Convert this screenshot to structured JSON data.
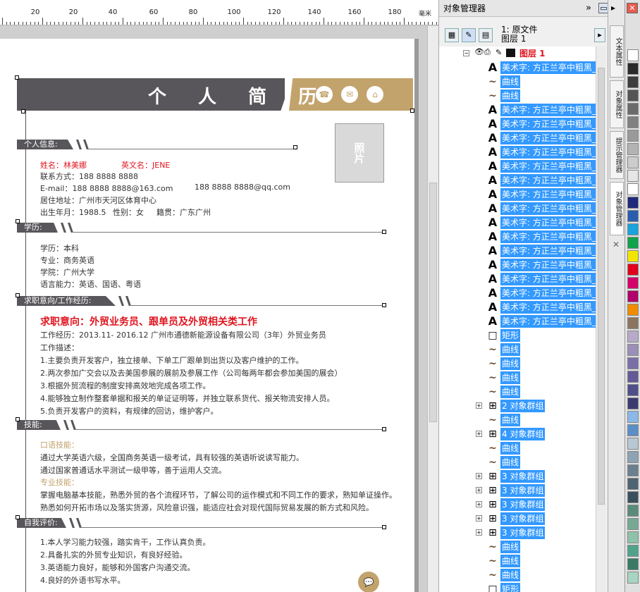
{
  "ruler": {
    "labels": [
      "20",
      "0",
      "20",
      "40",
      "60",
      "80",
      "100",
      "120",
      "140",
      "160",
      "180",
      "200"
    ],
    "unit": "毫米"
  },
  "resume": {
    "title": "个 人 简 历",
    "photo": "照片",
    "sections": {
      "s1": "个人信息:",
      "s2": "学历:",
      "s3": "求职意向/工作经历:",
      "s4": "技能:",
      "s5": "自我评价:"
    },
    "info": [
      "姓名：林美娜",
      "英文名：JENE",
      "联系方式：188 8888 8888",
      "E-mail：188 8888 8888@163.com",
      "188 8888 8888@qq.com",
      "居住地址：广州市天河区体育中心",
      "出生年月：1988.5",
      "性别：女",
      "籍贯：广东广州"
    ],
    "edu": [
      "学历：本科",
      "专业：商务英语",
      "学院：广州大学",
      "语言能力：英语、国语、粤语"
    ],
    "job": {
      "intent": "求职意向：外贸业务员、跟单员及外贸相关类工作",
      "exp": "工作经历：2013.11- 2016.12 广州市通德新能源设备有限公司（3年）外贸业务员",
      "desc": "工作描述：",
      "items": [
        "1.主要负责开发客户，独立接单、下单工厂跟单到出货以及客户维护的工作。",
        "2.两次参加广交会以及去美国参展的展前及参展工作（公司每两年都会参加美国的展会）",
        "3.根据外贸流程的制度安排高效地完成各项工作。",
        "4.能够独立制作整套单据和报关的单证证明等，并独立联系货代、报关物流安排人员。",
        "5.负责开发客户的资料，有规律的回访，维护客户。"
      ]
    },
    "skills": {
      "lang_head": "口语技能：",
      "lang": [
        "通过大学英语六级，全国商务英语一级考试，具有较强的英语听说读写能力。",
        "通过国家普通话水平测试一级甲等，善于运用人交流。"
      ],
      "pro_head": "专业技能：",
      "pro": [
        "掌握电脑基本技能，熟悉外贸的各个流程环节，了解公司的运作模式和不同工作的要求，熟知单证操作。",
        "熟悉如何开拓市场以及落实货源，风险意识强，能适应社会对现代国际贸易发展的新方式和风险。"
      ]
    },
    "eval": [
      "1.本人学习能力较强，踏实肯干，工作认真负责。",
      "2.具备扎实的外贸专业知识，有良好经验。",
      "3.英语能力良好，能够和外国客户沟通交流。",
      "4.良好的外语书写水平。"
    ]
  },
  "docker": {
    "title": "对象管理器",
    "doc_label": "1: 原文件",
    "layer_label": "图层 1",
    "layer_name": "图层 1",
    "rows": [
      {
        "icon": "A",
        "label": "美术字: 方正兰亭中粗黑_"
      },
      {
        "icon": "~",
        "label": "曲线"
      },
      {
        "icon": "~",
        "label": "曲线"
      },
      {
        "icon": "A",
        "label": "美术字: 方正兰亭中粗黑_"
      },
      {
        "icon": "A",
        "label": "美术字: 方正兰亭中粗黑_"
      },
      {
        "icon": "A",
        "label": "美术字: 方正兰亭中粗黑_"
      },
      {
        "icon": "A",
        "label": "美术字: 方正兰亭中粗黑_"
      },
      {
        "icon": "A",
        "label": "美术字: 方正兰亭中粗黑_"
      },
      {
        "icon": "A",
        "label": "美术字: 方正兰亭中粗黑_"
      },
      {
        "icon": "A",
        "label": "美术字: 方正兰亭中粗黑_"
      },
      {
        "icon": "A",
        "label": "美术字: 方正兰亭中粗黑_"
      },
      {
        "icon": "A",
        "label": "美术字: 方正兰亭中粗黑_"
      },
      {
        "icon": "A",
        "label": "美术字: 方正兰亭中粗黑_"
      },
      {
        "icon": "A",
        "label": "美术字: 方正兰亭中粗黑_"
      },
      {
        "icon": "A",
        "label": "美术字: 方正兰亭中粗黑_"
      },
      {
        "icon": "A",
        "label": "美术字: 方正兰亭中粗黑_"
      },
      {
        "icon": "A",
        "label": "美术字: 方正兰亭中粗黑_"
      },
      {
        "icon": "A",
        "label": "美术字: 方正兰亭中粗黑_"
      },
      {
        "icon": "A",
        "label": "美术字: 方正兰亭中粗黑_"
      },
      {
        "icon": "□",
        "label": "矩形"
      },
      {
        "icon": "~",
        "label": "曲线"
      },
      {
        "icon": "~",
        "label": "曲线"
      },
      {
        "icon": "~",
        "label": "曲线"
      },
      {
        "icon": "~",
        "label": "曲线"
      },
      {
        "icon": "⊞",
        "label": "2 对象群组",
        "group": true
      },
      {
        "icon": "~",
        "label": "曲线"
      },
      {
        "icon": "⊞",
        "label": "4 对象群组",
        "group": true
      },
      {
        "icon": "~",
        "label": "曲线"
      },
      {
        "icon": "~",
        "label": "曲线"
      },
      {
        "icon": "⊞",
        "label": "3 对象群组",
        "group": true
      },
      {
        "icon": "⊞",
        "label": "3 对象群组",
        "group": true
      },
      {
        "icon": "⊞",
        "label": "3 对象群组",
        "group": true
      },
      {
        "icon": "⊞",
        "label": "3 对象群组",
        "group": true
      },
      {
        "icon": "⊞",
        "label": "3 对象群组",
        "group": true
      },
      {
        "icon": "~",
        "label": "曲线"
      },
      {
        "icon": "~",
        "label": "曲线"
      },
      {
        "icon": "~",
        "label": "曲线"
      },
      {
        "icon": "□",
        "label": "矩形"
      }
    ]
  },
  "side_tabs": [
    "文本属性",
    "对象属性",
    "提示管理器",
    "对象管理器"
  ],
  "palette": [
    "#ffffff",
    "#2b2b2b",
    "#3d3d3d",
    "#555",
    "#6b6b6b",
    "#808080",
    "#9a9a9a",
    "#b3b3b3",
    "#cccccc",
    "#e6e6e6",
    "#ffffff",
    "#1f2a7a",
    "#2a5db0",
    "#1aa3dc",
    "#12a24b",
    "#f2e600",
    "#e2001a",
    "#d4006a",
    "#b0006a",
    "#f08c00",
    "#8a7560",
    "#b8a9c9",
    "#9b8fb8",
    "#7b6fa8",
    "#655a96",
    "#4f4f8a",
    "#3b3b70",
    "#8bb8e8",
    "#5b8ec7",
    "#b8c7d4",
    "#8ea3b3",
    "#6a7f8f",
    "#4f6472",
    "#3a4f5c",
    "#5a8a7a",
    "#76a893",
    "#8fc2a8",
    "#4fa38a",
    "#3a7a65",
    "#a8d4c2"
  ]
}
